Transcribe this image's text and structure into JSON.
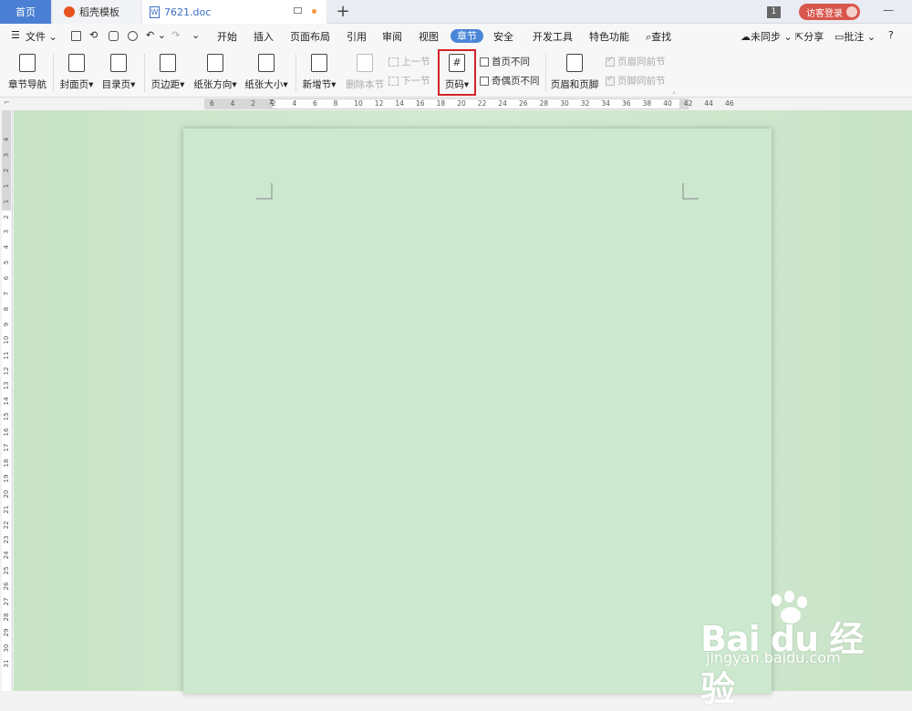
{
  "tabs": {
    "home": "首页",
    "templates": "稻壳模板",
    "document": "7621.doc",
    "add": "+"
  },
  "topright": {
    "badge": "1",
    "login": "访客登录",
    "minimize": "—"
  },
  "menu": {
    "file": "文件",
    "items": [
      "开始",
      "插入",
      "页面布局",
      "引用",
      "审阅",
      "视图",
      "章节",
      "安全",
      "开发工具",
      "特色功能"
    ],
    "active": "章节",
    "search": "查找",
    "sync": "未同步",
    "share": "分享",
    "comment": "批注",
    "help": "?"
  },
  "ribbon": {
    "nav": "章节导航",
    "cover": "封面页",
    "toc": "目录页",
    "margin": "页边距",
    "orientation": "纸张方向",
    "size": "纸张大小",
    "new_section": "新增节",
    "delete_section": "删除本节",
    "prev_section": "上一节",
    "next_section": "下一节",
    "page_number": "页码",
    "first_diff": "首页不同",
    "odd_even_diff": "奇偶页不同",
    "header_footer": "页眉和页脚",
    "header_same": "页眉同前节",
    "footer_same": "页脚同前节"
  },
  "hruler_numbers": [
    "6",
    "4",
    "2",
    "2",
    "4",
    "6",
    "8",
    "10",
    "12",
    "14",
    "16",
    "18",
    "20",
    "22",
    "24",
    "26",
    "28",
    "30",
    "32",
    "34",
    "36",
    "38",
    "40",
    "42",
    "44",
    "46"
  ],
  "vruler_numbers": [
    "4",
    "3",
    "2",
    "1",
    "1",
    "2",
    "3",
    "4",
    "5",
    "6",
    "7",
    "8",
    "9",
    "10",
    "11",
    "12",
    "13",
    "14",
    "15",
    "16",
    "17",
    "18",
    "19",
    "20",
    "21",
    "22",
    "23",
    "24",
    "25",
    "26",
    "27",
    "28",
    "29",
    "30",
    "31"
  ],
  "watermark": {
    "logo": "Bai du 经验",
    "url": "jingyan.baidu.com"
  },
  "colors": {
    "accent": "#4a86d8",
    "page": "#cce8cf",
    "highlight": "#d2232a",
    "login": "#d8564c"
  }
}
